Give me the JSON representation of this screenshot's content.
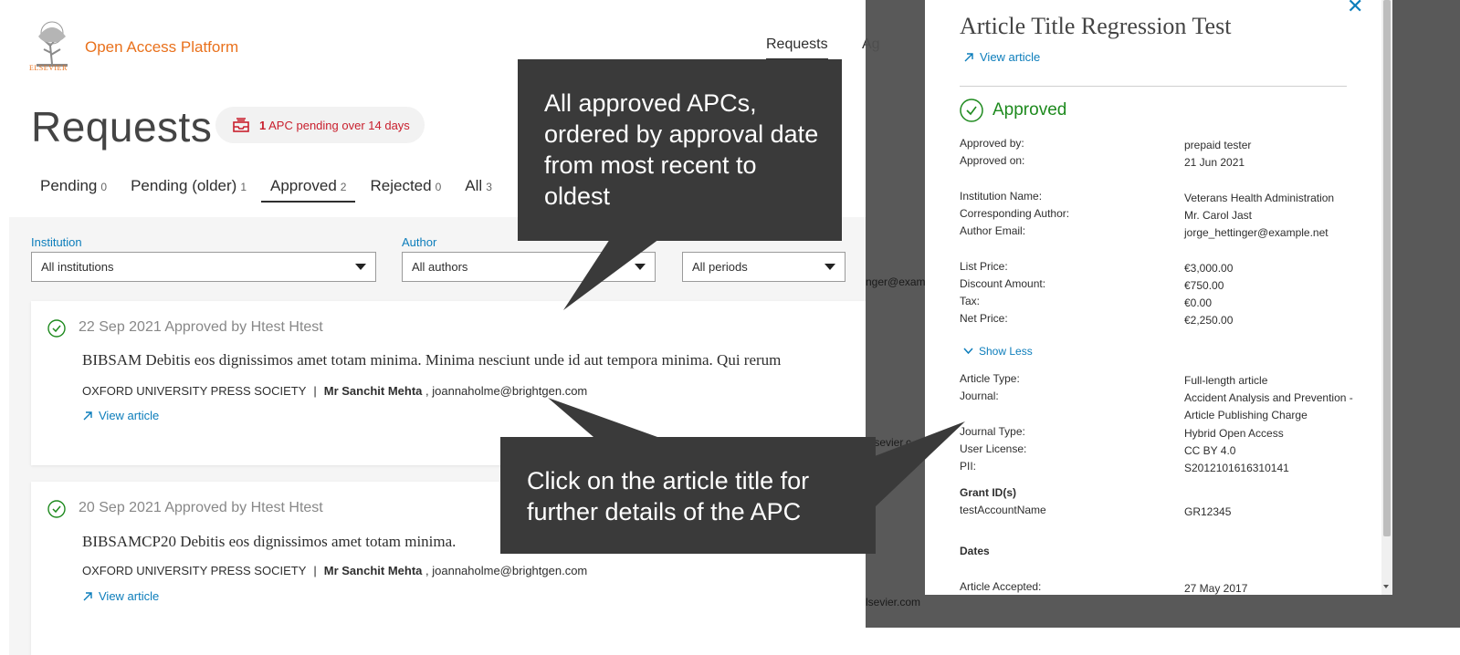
{
  "app": {
    "logo_text": "ELSEVIER",
    "name": "Open Access Platform",
    "nav": [
      "Requests",
      "Ag"
    ]
  },
  "page": {
    "title": "Requests",
    "badge": {
      "count": "1",
      "text": "APC pending over 14 days"
    },
    "tabs": [
      {
        "label": "Pending",
        "count": "0"
      },
      {
        "label": "Pending (older)",
        "count": "1"
      },
      {
        "label": "Approved",
        "count": "2"
      },
      {
        "label": "Rejected",
        "count": "0"
      },
      {
        "label": "All",
        "count": "3"
      }
    ],
    "filters": [
      {
        "label": "Institution",
        "value": "All institutions"
      },
      {
        "label": "Author",
        "value": "All authors"
      },
      {
        "label": "",
        "value": "All periods"
      }
    ]
  },
  "cards": [
    {
      "meta": "22 Sep 2021 Approved by Htest Htest",
      "title": "BIBSAM Debitis eos dignissimos amet totam minima. Minima nesciunt unde id aut tempora minima. Qui rerum",
      "publisher": "OXFORD UNIVERSITY PRESS SOCIETY",
      "author": "Mr Sanchit Mehta",
      "email": ", joannaholme@brightgen.com",
      "view": "View article"
    },
    {
      "meta": "20 Sep 2021 Approved by Htest Htest",
      "title": "BIBSAMCP20 Debitis eos dignissimos amet totam minima.",
      "publisher": "OXFORD UNIVERSITY PRESS SOCIETY",
      "author": "Mr Sanchit Mehta",
      "email": ", joannaholme@brightgen.com",
      "view": "View article"
    }
  ],
  "background_fragments": [
    "nger@exam",
    "elsevier.c",
    "lsevier.com"
  ],
  "panel": {
    "title": "Article Title Regression Test",
    "view": "View article",
    "status": "Approved",
    "rows1": [
      {
        "label": "Approved by:",
        "value": "prepaid tester"
      },
      {
        "label": "Approved on:",
        "value": "21 Jun 2021"
      }
    ],
    "rows2": [
      {
        "label": "Institution Name:",
        "value": "Veterans Health Administration"
      },
      {
        "label": "Corresponding Author:",
        "value": "Mr. Carol Jast"
      },
      {
        "label": "Author Email:",
        "value": "jorge_hettinger@example.net"
      }
    ],
    "rows3": [
      {
        "label": "List Price:",
        "value": "€3,000.00"
      },
      {
        "label": "Discount Amount:",
        "value": "€750.00"
      },
      {
        "label": "Tax:",
        "value": "€0.00"
      },
      {
        "label": "Net Price:",
        "value": "€2,250.00"
      }
    ],
    "show_less": "Show Less",
    "rows4": [
      {
        "label": "Article Type:",
        "value": "Full-length article"
      },
      {
        "label": "Journal:",
        "value": "Accident Analysis and Prevention - Article Publishing Charge"
      },
      {
        "label": "Journal Type:",
        "value": "Hybrid Open Access"
      },
      {
        "label": "User License:",
        "value": "CC BY 4.0"
      },
      {
        "label": "PII:",
        "value": "S2012101616310141"
      }
    ],
    "grant_heading": "Grant ID(s)",
    "grant": {
      "label": "testAccountName",
      "value": "GR12345"
    },
    "dates_heading": "Dates",
    "dates": [
      {
        "label": "Article Accepted:",
        "value": "27 May 2017"
      }
    ]
  },
  "callouts": {
    "top": "All approved APCs, ordered by approval date from most recent to oldest",
    "bottom": "Click on the article title for further details of the APC"
  },
  "colors": {
    "brand": "#e9711c",
    "link": "#0c7dbb",
    "approved": "#1e8a1e",
    "alert": "#c9202e",
    "callout": "#3a3a3a"
  }
}
